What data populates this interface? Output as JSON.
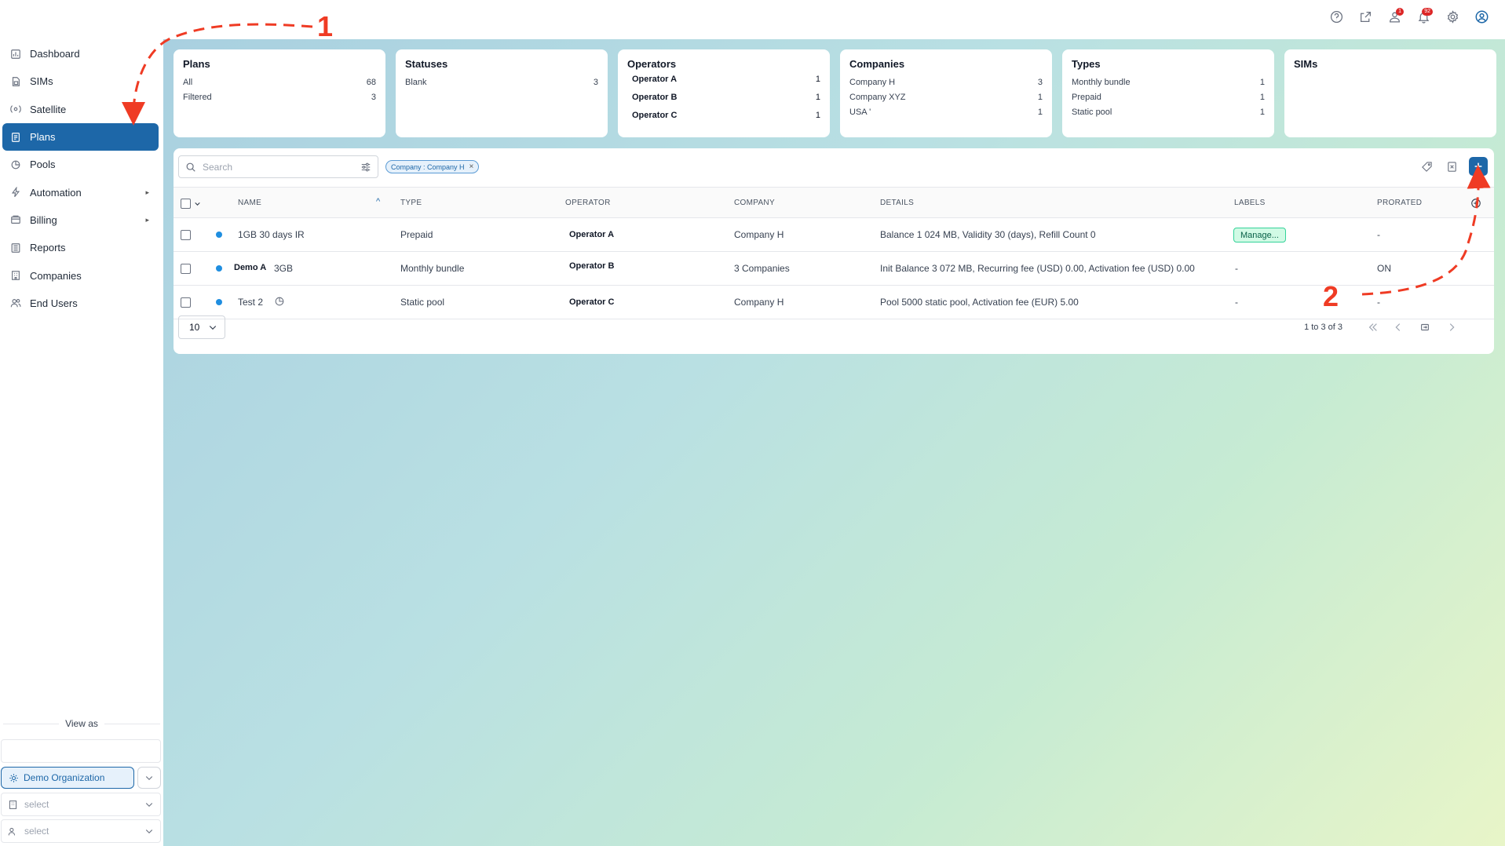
{
  "sidebar": {
    "items": [
      {
        "label": "Dashboard",
        "icon": "dashboard-icon"
      },
      {
        "label": "SIMs",
        "icon": "sim-icon"
      },
      {
        "label": "Satellite",
        "icon": "satellite-icon"
      },
      {
        "label": "Plans",
        "icon": "plans-icon",
        "active": true
      },
      {
        "label": "Pools",
        "icon": "pools-icon"
      },
      {
        "label": "Automation",
        "icon": "automation-icon",
        "caret": "▸"
      },
      {
        "label": "Billing",
        "icon": "billing-icon",
        "caret": "▸"
      },
      {
        "label": "Reports",
        "icon": "reports-icon"
      },
      {
        "label": "Companies",
        "icon": "companies-icon"
      },
      {
        "label": "End Users",
        "icon": "end-users-icon"
      }
    ],
    "view_as": {
      "label": "View as",
      "organization": "Demo Organization",
      "company_select_placeholder": "select",
      "user_select_placeholder": "select"
    }
  },
  "topbar": {
    "badges": {
      "contacts": "1",
      "notifications": "92"
    }
  },
  "cards": {
    "plans": {
      "title": "Plans",
      "rows": [
        {
          "k": "All",
          "v": "68"
        },
        {
          "k": "Filtered",
          "v": "3"
        }
      ]
    },
    "statuses": {
      "title": "Statuses",
      "rows": [
        {
          "k": "Blank",
          "v": "3"
        }
      ]
    },
    "operators": {
      "title": "Operators",
      "rows": [
        {
          "k": "Operator A",
          "v": "1"
        },
        {
          "k": "Operator B",
          "v": "1"
        },
        {
          "k": "Operator C",
          "v": "1"
        }
      ]
    },
    "companies": {
      "title": "Companies",
      "rows": [
        {
          "k": "Company H",
          "v": "3"
        },
        {
          "k": "Company XYZ",
          "v": "1"
        },
        {
          "k": "USA '",
          "v": "1"
        }
      ]
    },
    "types": {
      "title": "Types",
      "rows": [
        {
          "k": "Monthly bundle",
          "v": "1"
        },
        {
          "k": "Prepaid",
          "v": "1"
        },
        {
          "k": "Static pool",
          "v": "1"
        }
      ]
    },
    "sims": {
      "title": "SIMs"
    }
  },
  "table": {
    "search_placeholder": "Search",
    "filter_chip": "Company : Company H",
    "filter_chip_close": "×",
    "columns": {
      "name": "NAME",
      "type": "TYPE",
      "operator": "OPERATOR",
      "company": "COMPANY",
      "details": "DETAILS",
      "labels": "LABELS",
      "prorated": "PRORATED"
    },
    "sort_indicator": "^",
    "rows": [
      {
        "name": "1GB 30 days IR",
        "name_extra": "",
        "type": "Prepaid",
        "operator": "Operator A",
        "company": "Company H",
        "details": "Balance 1 024 MB, Validity 30 (days), Refill Count 0",
        "labels": "Manage...",
        "prorated": "-"
      },
      {
        "name": "Demo A",
        "name_extra": "3GB",
        "type": "Monthly bundle",
        "operator": "Operator B",
        "company": "3 Companies",
        "details": "Init Balance 3 072 MB, Recurring fee (USD) 0.00, Activation fee (USD) 0.00",
        "labels": "-",
        "prorated": "ON"
      },
      {
        "name": "Test 2",
        "name_extra": "",
        "type": "Static pool",
        "operator": "Operator C",
        "company": "Company H",
        "details": "Pool 5000 static pool, Activation fee (EUR) 5.00",
        "labels": "-",
        "prorated": "-"
      }
    ],
    "page_size": "10",
    "range": "1 to 3 of 3"
  },
  "annotations": {
    "step1": "1",
    "step2": "2",
    "color": "#ef3b24"
  }
}
